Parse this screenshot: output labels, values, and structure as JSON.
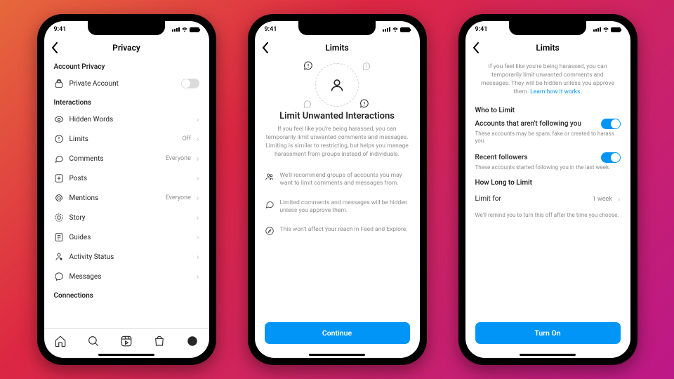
{
  "status": {
    "time": "9:41"
  },
  "screen1": {
    "title": "Privacy",
    "sec1": "Account Privacy",
    "private": "Private Account",
    "sec2": "Interactions",
    "items": [
      {
        "label": "Hidden Words",
        "value": ""
      },
      {
        "label": "Limits",
        "value": "Off"
      },
      {
        "label": "Comments",
        "value": "Everyone"
      },
      {
        "label": "Posts",
        "value": ""
      },
      {
        "label": "Mentions",
        "value": "Everyone"
      },
      {
        "label": "Story",
        "value": ""
      },
      {
        "label": "Guides",
        "value": ""
      },
      {
        "label": "Activity Status",
        "value": ""
      },
      {
        "label": "Messages",
        "value": ""
      }
    ],
    "sec3": "Connections"
  },
  "screen2": {
    "title": "Limits",
    "hero_title": "Limit Unwanted Interactions",
    "hero_desc": "If you feel like you're being harassed, you can temporarily limit unwanted comments and messages. Limiting is similar to restricting, but helps you manage harassment from groups instead of individuals.",
    "bullets": [
      "We'll recommend groups of accounts you may want to limit comments and messages from.",
      "Limited comments and messages will be hidden unless you approve them.",
      "This won't affect your reach in Feed and Explore."
    ],
    "cta": "Continue"
  },
  "screen3": {
    "title": "Limits",
    "intro": "If you feel like you're being harassed, you can temporarily limit unwanted comments and messages. They will be hidden unless you approve them. ",
    "intro_link": "Learn how it works",
    "sec1": "Who to Limit",
    "opt1_title": "Accounts that aren't following you",
    "opt1_desc": "These accounts may be spam, fake or created to harass you.",
    "opt2_title": "Recent followers",
    "opt2_desc": "These accounts started following you in the last week.",
    "sec2": "How Long to Limit",
    "limit_label": "Limit for",
    "limit_value": "1 week",
    "note": "We'll remind you to turn this off after the time you choose.",
    "cta": "Turn On"
  }
}
